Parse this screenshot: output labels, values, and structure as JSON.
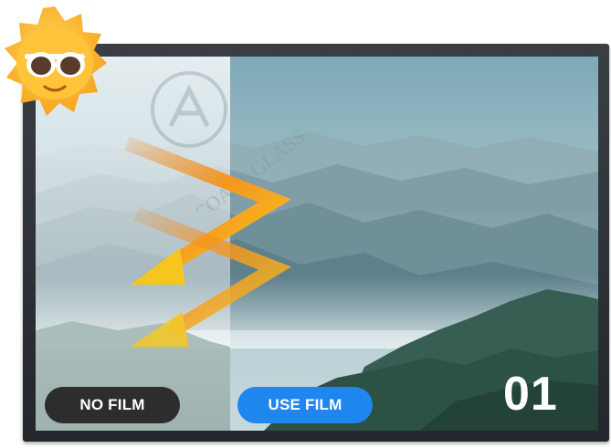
{
  "buttons": {
    "no_film": "NO FILM",
    "use_film": "USE FILM"
  },
  "step_number": "01",
  "watermark": {
    "text": "COAST GLASS"
  },
  "icons": {
    "badge": "sun-with-sunglasses-icon",
    "arrows": "sunlight-arrows-icon"
  },
  "colors": {
    "frame": "#2b2f33",
    "no_film_button": "#2d2d2d",
    "use_film_button": "#1f86f0",
    "tint": "#8fb3bd",
    "arrow": "#f5a623"
  }
}
